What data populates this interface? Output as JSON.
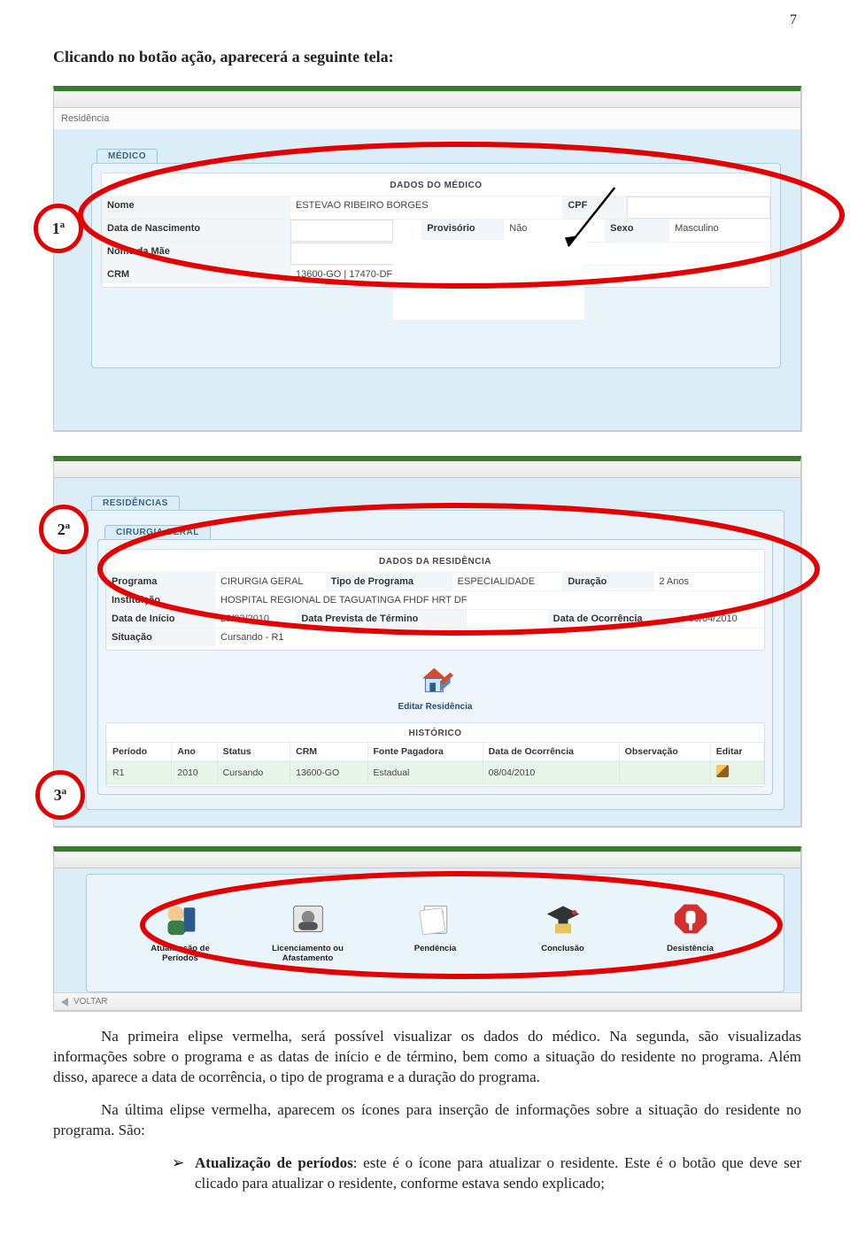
{
  "page_number": "7",
  "lead": "Clicando no botão ação, aparecerá a seguinte tela:",
  "annotations": {
    "n1": "1ª",
    "n2": "2ª",
    "n3": "3ª"
  },
  "shot1": {
    "breadcrumb": "Residência",
    "tab": "MÉDICO",
    "box_title": "DADOS DO MÉDICO",
    "rows": {
      "nome_l": "Nome",
      "nome_v": "ESTEVAO RIBEIRO BORGES",
      "cpf_l": "CPF",
      "cpf_v": "",
      "dob_l": "Data de Nascimento",
      "dob_v": "",
      "prov_l": "Provisório",
      "prov_v": "Não",
      "sexo_l": "Sexo",
      "sexo_v": "Masculino",
      "mae_l": "Nome da Mãe",
      "mae_v": "",
      "crm_l": "CRM",
      "crm_v": "13600-GO | 17470-DF"
    }
  },
  "shot2": {
    "tab_outer": "RESIDÊNCIAS",
    "tab_inner": "CIRURGIA GERAL",
    "box_title": "DADOS DA RESIDÊNCIA",
    "rows": {
      "prog_l": "Programa",
      "prog_v": "CIRURGIA GERAL",
      "tipo_l": "Tipo de Programa",
      "tipo_v": "ESPECIALIDADE",
      "dur_l": "Duração",
      "dur_v": "2 Anos",
      "inst_l": "Instituição",
      "inst_v": "HOSPITAL REGIONAL DE TAGUATINGA FHDF HRT DF",
      "dini_l": "Data de Início",
      "dini_v": "29/03/2010",
      "dprev_l": "Data Prevista de Término",
      "dprev_v": "",
      "doc_l": "Data de Ocorrência",
      "doc_v": "08/04/2010",
      "sit_l": "Situação",
      "sit_v": "Cursando - R1"
    },
    "editar_label": "Editar Residência",
    "hist_title": "HISTÓRICO",
    "hist_headers": [
      "Período",
      "Ano",
      "Status",
      "CRM",
      "Fonte Pagadora",
      "Data de Ocorrência",
      "Observação",
      "Editar"
    ],
    "hist_row": [
      "R1",
      "2010",
      "Cursando",
      "13600-GO",
      "Estadual",
      "08/04/2010",
      "",
      ""
    ]
  },
  "shot3": {
    "actions": [
      {
        "label": "Atualização de Períodos"
      },
      {
        "label": "Licenciamento ou Afastamento"
      },
      {
        "label": "Pendência"
      },
      {
        "label": "Conclusão"
      },
      {
        "label": "Desistência"
      }
    ],
    "voltar": "VOLTAR"
  },
  "para1": "Na primeira elipse vermelha, será possível visualizar os dados do médico. Na segunda, são visualizadas informações sobre o programa e as datas de início e de término, bem como a situação do residente no programa. Além disso, aparece a data de ocorrência, o tipo de programa e a duração do programa.",
  "para2": "Na última elipse vermelha, aparecem os ícones para inserção de informações sobre a situação do residente no programa. São:",
  "bullet1_bold": "Atualização de períodos",
  "bullet1_rest": ": este é o ícone para atualizar o residente. Este é o botão que deve ser clicado para atualizar o residente, conforme estava sendo explicado;"
}
